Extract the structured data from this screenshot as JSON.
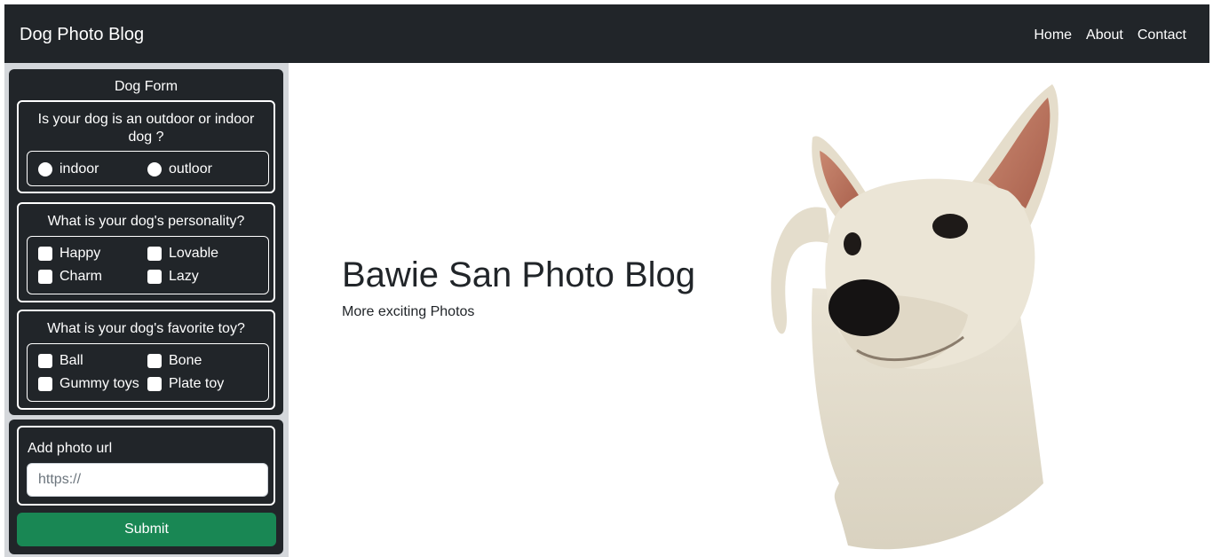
{
  "navbar": {
    "brand": "Dog Photo Blog",
    "links": [
      "Home",
      "About",
      "Contact"
    ]
  },
  "form": {
    "title": "Dog Form",
    "q1": {
      "question": "Is your dog is an outdoor or indoor dog ?",
      "options": [
        "indoor",
        "outloor"
      ]
    },
    "q2": {
      "question": "What is your dog's personality?",
      "options": [
        "Happy",
        "Lovable",
        "Charm",
        "Lazy"
      ]
    },
    "q3": {
      "question": "What is your dog's favorite toy?",
      "options": [
        "Ball",
        "Bone",
        "Gummy toys",
        "Plate toy"
      ]
    },
    "photo": {
      "label": "Add photo url",
      "placeholder": "https://",
      "value": ""
    },
    "submit_label": "Submit"
  },
  "hero": {
    "title": "Bawie San Photo Blog",
    "subtitle": "More exciting Photos"
  },
  "colors": {
    "dark": "#212529",
    "submit": "#198754",
    "sidebar_bg": "#d4d7db"
  },
  "icons": {
    "dog_photo": "dog-photo-image"
  }
}
